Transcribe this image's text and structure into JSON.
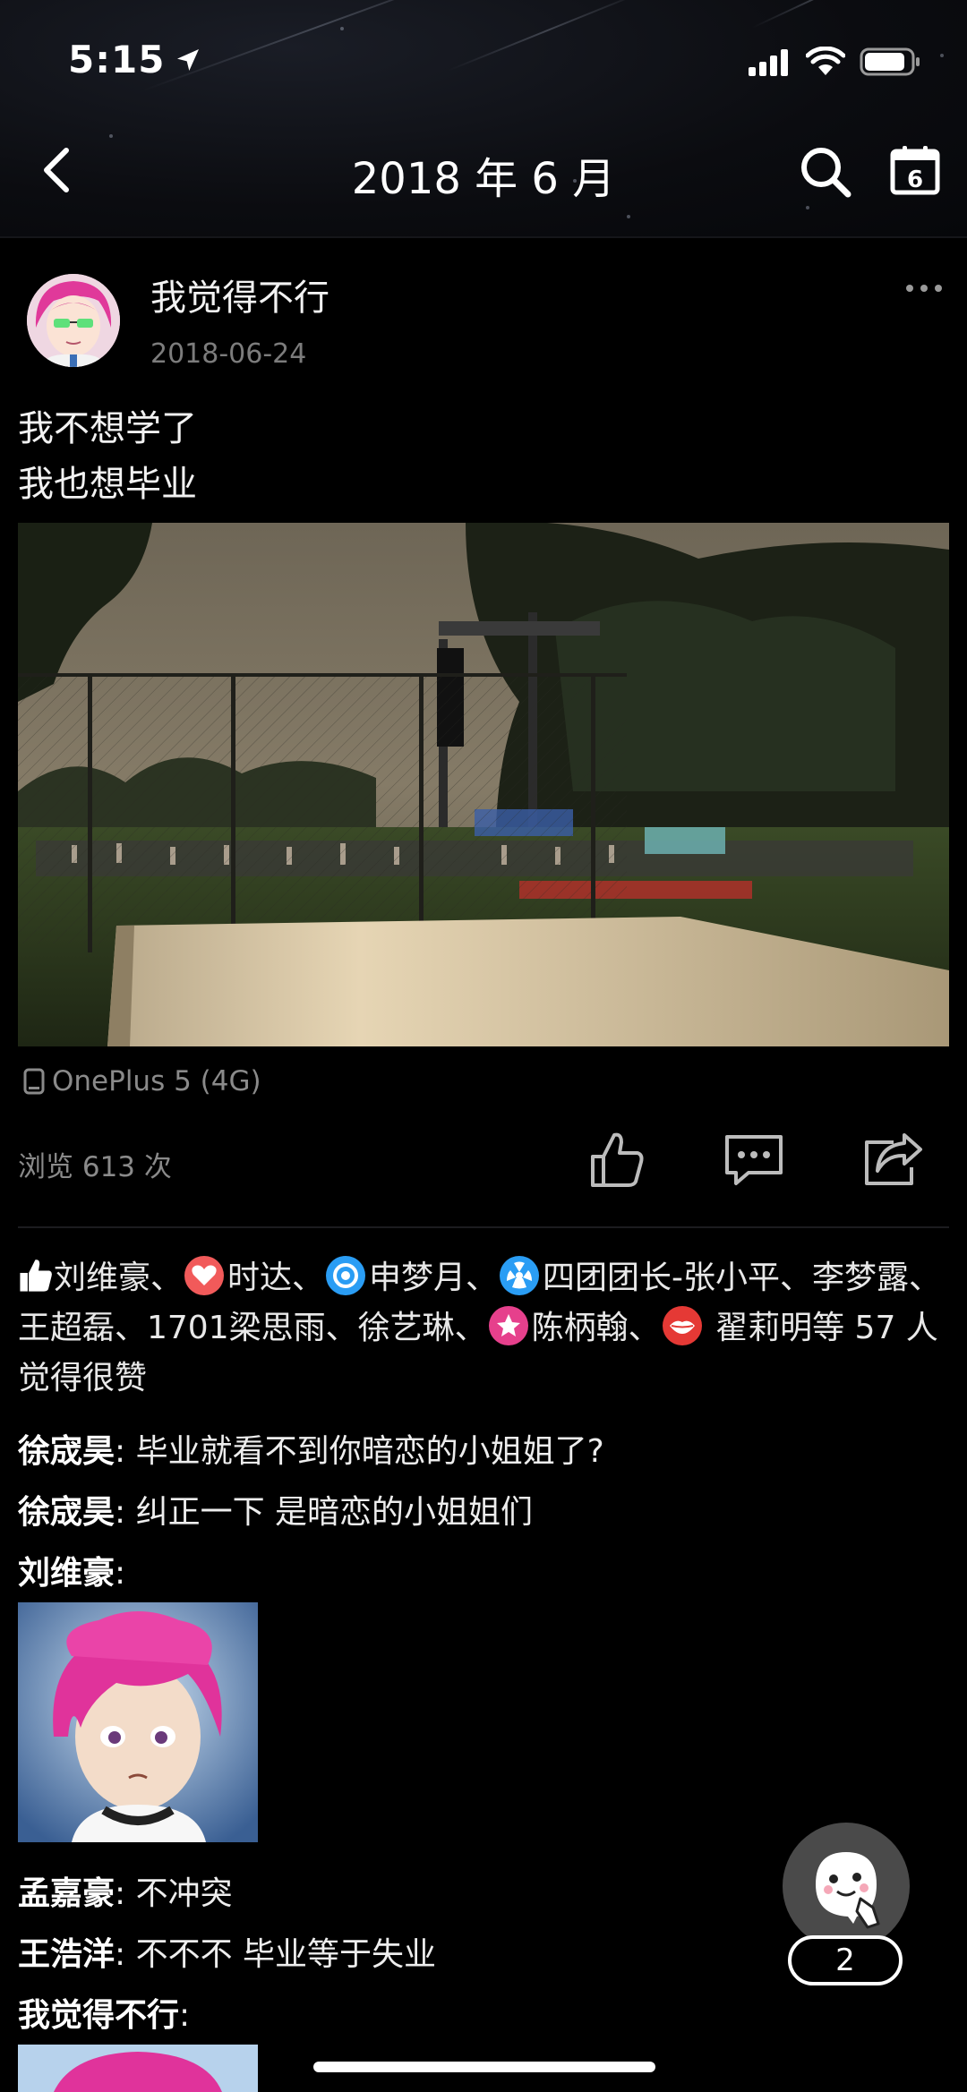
{
  "status_bar": {
    "time": "5:15"
  },
  "nav": {
    "title": "2018 年 6 月",
    "calendar_day": "6"
  },
  "post": {
    "author": "我觉得不行",
    "date": "2018-06-24",
    "lines": [
      "我不想学了",
      "我也想毕业"
    ],
    "device": "OnePlus 5 (4G)",
    "views": "浏览 613 次"
  },
  "likes": {
    "names": {
      "n1": "刘维豪、",
      "n2": "时达、",
      "n3": "申梦月、",
      "n4": "四团团长-张小平、李梦露、王超磊、1701梁思雨、徐艺琳、",
      "n5": "陈柄翰、",
      "n6": "翟莉明等 57 人觉得很赞"
    },
    "colors": {
      "heart": "#f15a5a",
      "ring": "#2a9df4",
      "badge": "#2a9df4",
      "star": "#e6408c",
      "lips": "#e53935"
    }
  },
  "comments": [
    {
      "user": "徐宬昊",
      "sep": ": ",
      "text": "毕业就看不到你暗恋的小姐姐了?"
    },
    {
      "user": "徐宬昊",
      "sep": ": ",
      "text": "纠正一下 是暗恋的小姐姐们"
    },
    {
      "user": "刘维豪",
      "sep": ":",
      "text": ""
    },
    {
      "user": "孟嘉豪",
      "sep": ": ",
      "text": "不冲突"
    },
    {
      "user": "王浩洋",
      "sep": ": ",
      "text": "不不不 毕业等于失业"
    },
    {
      "user": "我觉得不行",
      "sep": ":",
      "text": ""
    }
  ],
  "fab": {
    "count": "2"
  },
  "icons": {
    "back": "chevron-left-icon",
    "search": "search-icon",
    "calendar": "calendar-icon",
    "more": "more-dots-icon",
    "phone": "phone-icon",
    "like": "thumbs-up-icon",
    "comment": "comment-icon",
    "share": "share-icon"
  }
}
